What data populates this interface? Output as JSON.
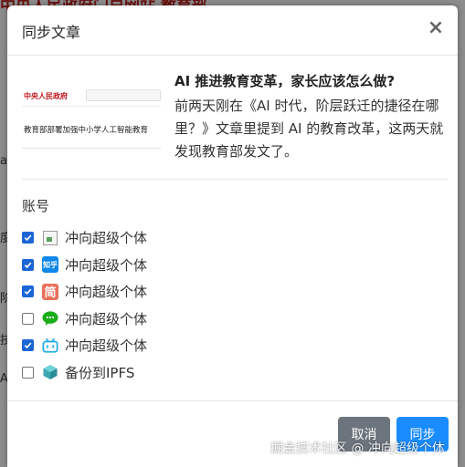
{
  "background": {
    "edge_chars": [
      "a",
      "度",
      "阶",
      "技",
      "AI"
    ]
  },
  "dialog": {
    "title": "同步文章",
    "close_glyph": "×"
  },
  "article": {
    "title": "AI 推进教育变革，家长应该怎么做?",
    "body": "前两天刚在《AI 时代，阶层跃迁的捷径在哪里？》文章里提到 AI 的教育改革，这两天就发现教育部发文了。",
    "thumbnail": {
      "logo_text": "中央人民政府",
      "headline": "教育部部署加强中小学人工智能教育"
    }
  },
  "accounts": {
    "label": "账号",
    "items": [
      {
        "label": "冲向超级个体",
        "checked": true,
        "icon": "broken-image-icon"
      },
      {
        "label": "冲向超级个体",
        "checked": true,
        "icon": "zhihu-icon",
        "icon_text": "知乎"
      },
      {
        "label": "冲向超级个体",
        "checked": true,
        "icon": "jianshu-icon",
        "icon_text": "简"
      },
      {
        "label": "冲向超级个体",
        "checked": false,
        "icon": "wechat-icon"
      },
      {
        "label": "冲向超级个体",
        "checked": true,
        "icon": "bilibili-icon"
      },
      {
        "label": "备份到IPFS",
        "checked": false,
        "icon": "ipfs-cube-icon"
      }
    ]
  },
  "footer": {
    "cancel_label": "取消",
    "sync_label": "同步"
  },
  "watermark": "掘金技术社区 @ 冲向超级个体",
  "colors": {
    "primary": "#1a8cff",
    "secondary": "#6c757d",
    "checkbox": "#1b66d6",
    "wechat": "#1aad19",
    "bilibili": "#23ade5",
    "zhihu": "#0f88eb",
    "jianshu": "#e9705a"
  }
}
